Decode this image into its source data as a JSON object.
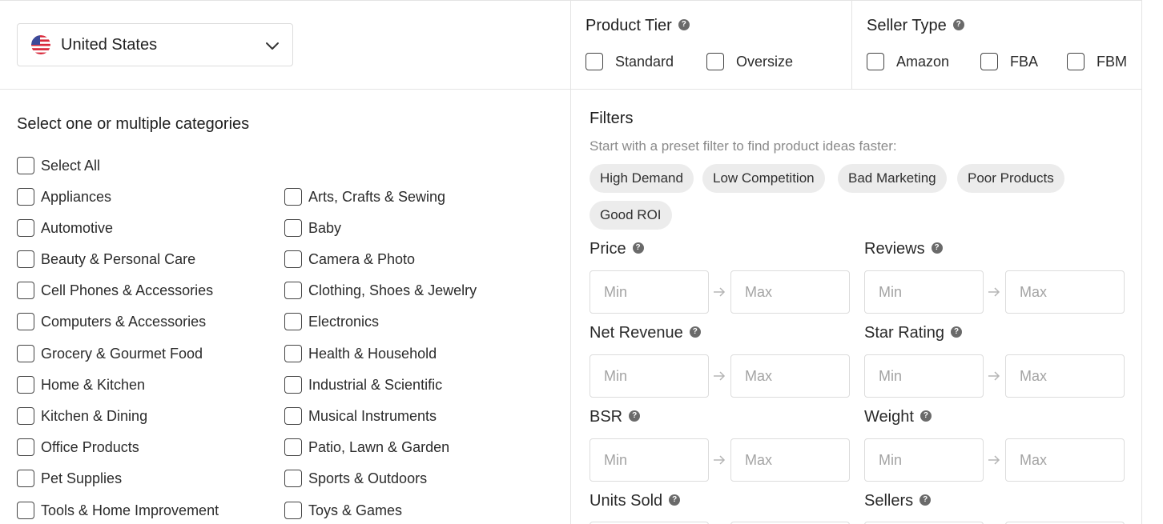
{
  "country": {
    "selected": "United States",
    "flag_icon": "us-flag-icon"
  },
  "product_tier": {
    "title": "Product Tier",
    "options": [
      "Standard",
      "Oversize"
    ]
  },
  "seller_type": {
    "title": "Seller Type",
    "options": [
      "Amazon",
      "FBA",
      "FBM"
    ]
  },
  "categories": {
    "title": "Select one or multiple categories",
    "select_all": "Select All",
    "left": [
      "Appliances",
      "Automotive",
      "Beauty & Personal Care",
      "Cell Phones & Accessories",
      "Computers & Accessories",
      "Grocery & Gourmet Food",
      "Home & Kitchen",
      "Kitchen & Dining",
      "Office Products",
      "Pet Supplies",
      "Tools & Home Improvement"
    ],
    "right": [
      "Arts, Crafts & Sewing",
      "Baby",
      "Camera & Photo",
      "Clothing, Shoes & Jewelry",
      "Electronics",
      "Health & Household",
      "Industrial & Scientific",
      "Musical Instruments",
      "Patio, Lawn & Garden",
      "Sports & Outdoors",
      "Toys & Games"
    ]
  },
  "filters": {
    "title": "Filters",
    "subtitle": "Start with a preset filter to find product ideas faster:",
    "presets": [
      "High Demand",
      "Low Competition",
      "Bad Marketing",
      "Poor Products",
      "Good ROI"
    ],
    "min_placeholder": "Min",
    "max_placeholder": "Max",
    "fields": [
      "Price",
      "Reviews",
      "Net Revenue",
      "Star Rating",
      "BSR",
      "Weight",
      "Units Sold",
      "Sellers"
    ]
  },
  "colors": {
    "border": "#dcdcdc",
    "chip_bg": "#ececec",
    "text": "#2b2b2b",
    "muted": "#8a8a8a"
  }
}
